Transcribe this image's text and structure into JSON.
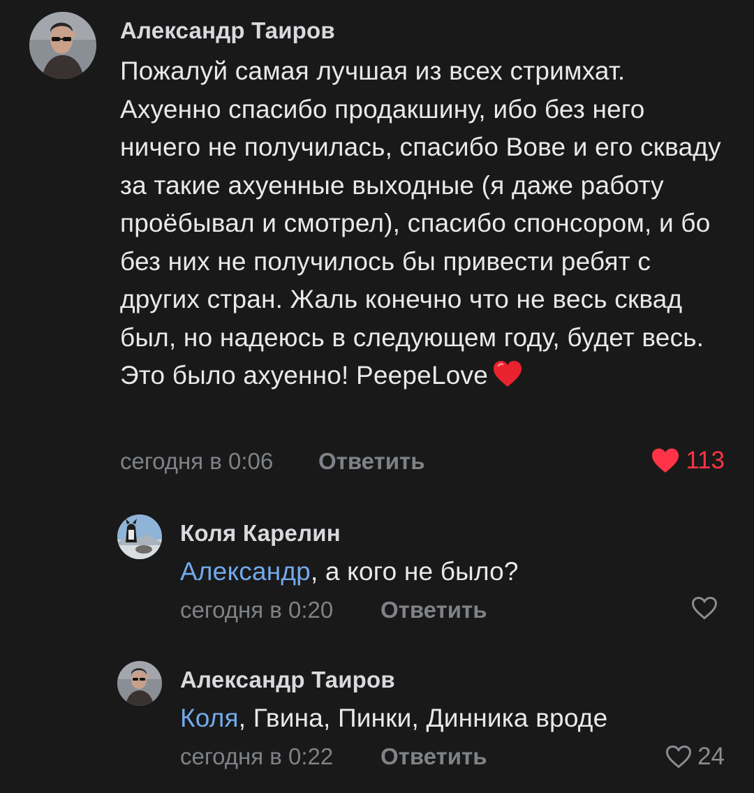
{
  "comments": [
    {
      "author": "Александр Таиров",
      "text_before_emoji": "Пожалуй самая лучшая из всех стримхат. Ахуенно спасибо продакшину, ибо без него ничего не получилась, спасибо Вове и его скваду за такие ахуенные выходные (я даже работу проёбывал и смотрел), спасибо спонсором, и бо без них не получилось бы привести ребят с других стран. Жаль конечно что не весь сквад был, но надеюсь в следующем году, будет весь. Это было ахуенно! PeepeLove",
      "emoji": "red-heart-emoji",
      "time": "сегодня в 0:06",
      "reply_label": "Ответить",
      "likes": "113",
      "liked": true,
      "like_color": "#ff3347"
    },
    {
      "author": "Коля Карелин",
      "mention": "Александр",
      "text": ", а кого не было?",
      "time": "сегодня в 0:20",
      "reply_label": "Ответить",
      "likes": "",
      "liked": false
    },
    {
      "author": "Александр Таиров",
      "mention": "Коля",
      "text": ", Гвина, Пинки, Динника вроде",
      "time": "сегодня в 0:22",
      "reply_label": "Ответить",
      "likes": "24",
      "liked": false
    }
  ],
  "colors": {
    "background": "#191919",
    "mention": "#71aaeb",
    "meta": "#7f8286",
    "like_active": "#ff3347"
  }
}
